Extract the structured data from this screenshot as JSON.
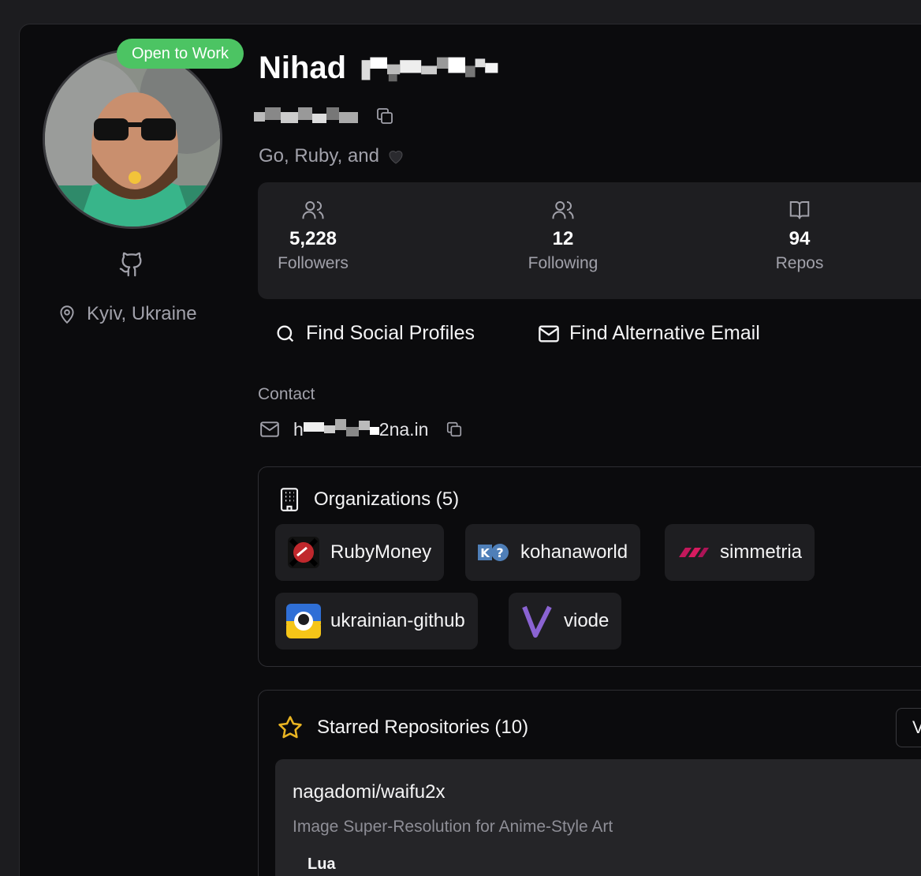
{
  "profile": {
    "open_to_work": "Open to Work",
    "name": "Nihad",
    "bio": "Go, Ruby, and",
    "location": "Kyiv, Ukraine"
  },
  "stats": [
    {
      "value": "5,228",
      "label": "Followers",
      "icon": "users-icon"
    },
    {
      "value": "12",
      "label": "Following",
      "icon": "users-icon"
    },
    {
      "value": "94",
      "label": "Repos",
      "icon": "book-icon"
    }
  ],
  "actions": {
    "find_social": "Find Social Profiles",
    "find_email": "Find Alternative Email"
  },
  "contact": {
    "label": "Contact",
    "email_visible_prefix": "h",
    "email_visible_suffix": "2na.in"
  },
  "organizations": {
    "title": "Organizations (5)",
    "items": [
      {
        "name": "RubyMoney"
      },
      {
        "name": "kohanaworld"
      },
      {
        "name": "simmetria"
      },
      {
        "name": "ukrainian-github"
      },
      {
        "name": "viode"
      }
    ]
  },
  "starred": {
    "title": "Starred Repositories (10)",
    "view_button": "V",
    "repos": [
      {
        "name": "nagadomi/waifu2x",
        "description": "Image Super-Resolution for Anime-Style Art",
        "language": "Lua"
      }
    ]
  },
  "colors": {
    "accent_green": "#4cc463",
    "star_yellow": "#e9b422",
    "background": "#0b0b0d"
  }
}
